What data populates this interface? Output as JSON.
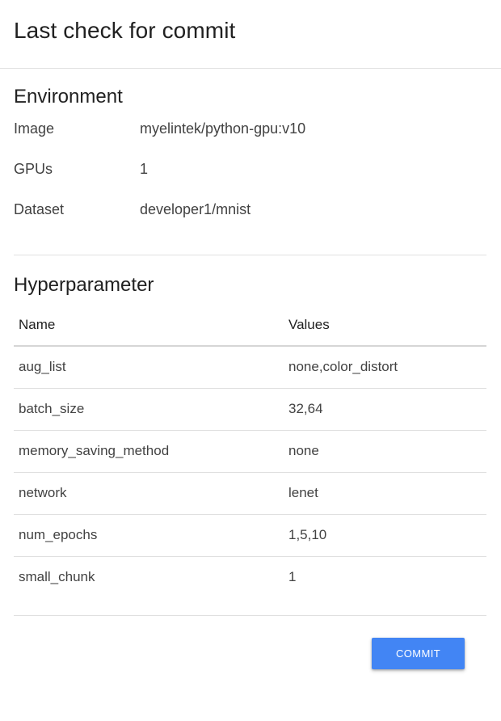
{
  "dialog": {
    "title": "Last check for commit"
  },
  "environment": {
    "heading": "Environment",
    "rows": [
      {
        "label": "Image",
        "value": "myelintek/python-gpu:v10"
      },
      {
        "label": "GPUs",
        "value": "1"
      },
      {
        "label": "Dataset",
        "value": "developer1/mnist"
      }
    ]
  },
  "hyperparameter": {
    "heading": "Hyperparameter",
    "columns": {
      "name": "Name",
      "values": "Values"
    },
    "rows": [
      {
        "name": "aug_list",
        "values": "none,color_distort"
      },
      {
        "name": "batch_size",
        "values": "32,64"
      },
      {
        "name": "memory_saving_method",
        "values": "none"
      },
      {
        "name": "network",
        "values": "lenet"
      },
      {
        "name": "num_epochs",
        "values": "1,5,10"
      },
      {
        "name": "small_chunk",
        "values": "1"
      }
    ]
  },
  "actions": {
    "commit_label": "COMMIT"
  },
  "colors": {
    "accent": "#4285f4",
    "divider": "#e0e0e0",
    "text": "#212121"
  }
}
